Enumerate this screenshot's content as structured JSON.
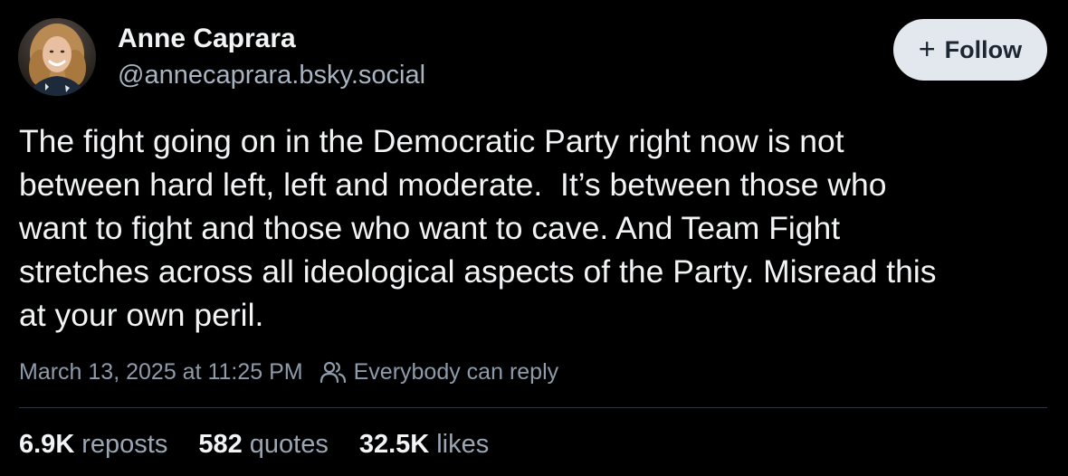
{
  "author": {
    "name": "Anne Caprara",
    "handle": "@annecaprara.bsky.social"
  },
  "follow_button": {
    "icon": "plus-icon",
    "label": "Follow"
  },
  "post": {
    "text": "The fight going on in the Democratic Party right now is not\nbetween hard left, left and moderate.  It’s between those who\nwant to fight and those who want to cave. And Team Fight\nstretches across all ideological aspects of the Party. Misread this\nat your own peril.",
    "timestamp": "March 13, 2025 at 11:25 PM",
    "reply_setting_icon": "people-icon",
    "reply_setting": "Everybody can reply"
  },
  "stats": [
    {
      "value": "6.9K",
      "label": "reposts"
    },
    {
      "value": "582",
      "label": "quotes"
    },
    {
      "value": "32.5K",
      "label": "likes"
    }
  ],
  "colors": {
    "background": "#000000",
    "primary_text": "#f1f3f5",
    "secondary_text": "#8e9bab",
    "button_bg": "#e3e8ee",
    "button_text": "#1d2733",
    "divider": "#2e3540"
  }
}
